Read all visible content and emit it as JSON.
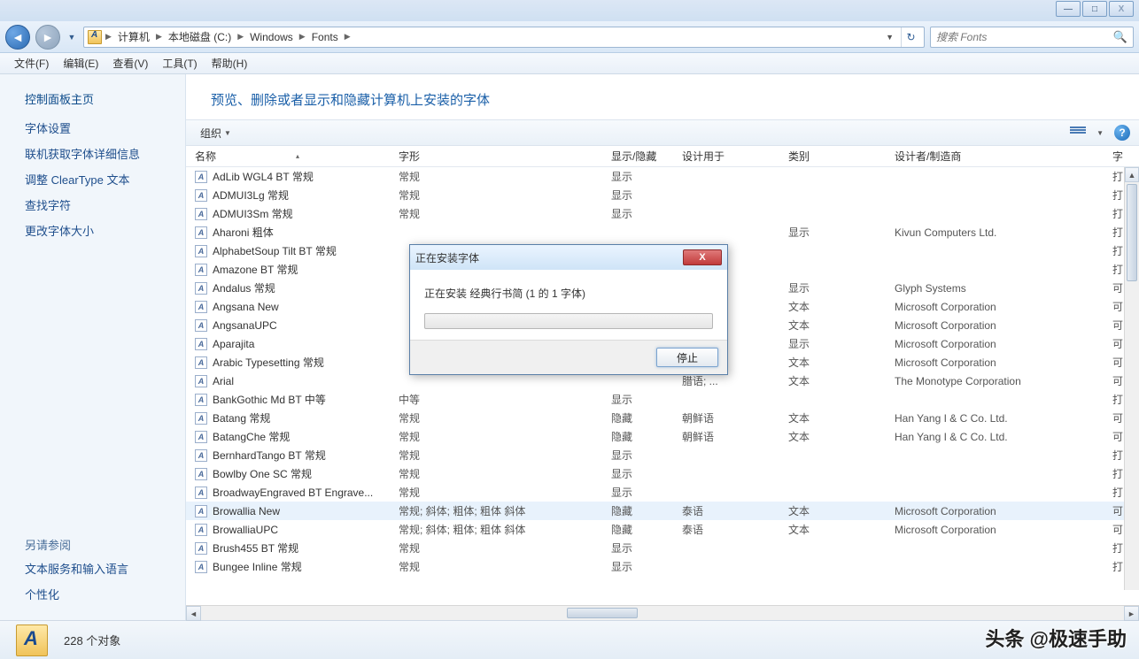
{
  "titlebar": {
    "minimize": "—",
    "maximize": "□",
    "close": "X"
  },
  "nav": {
    "crumbs": [
      "计算机",
      "本地磁盘 (C:)",
      "Windows",
      "Fonts"
    ],
    "search_placeholder": "搜索 Fonts"
  },
  "menus": [
    "文件(F)",
    "编辑(E)",
    "查看(V)",
    "工具(T)",
    "帮助(H)"
  ],
  "sidebar": {
    "home": "控制面板主页",
    "links": [
      "字体设置",
      "联机获取字体详细信息",
      "调整 ClearType 文本",
      "查找字符",
      "更改字体大小"
    ],
    "see_also": "另请参阅",
    "sub": [
      "文本服务和输入语言",
      "个性化"
    ]
  },
  "heading": "预览、删除或者显示和隐藏计算机上安装的字体",
  "toolbar": {
    "organize": "组织"
  },
  "columns": {
    "name": "名称",
    "style": "字形",
    "show": "显示/隐藏",
    "designfor": "设计用于",
    "category": "类别",
    "designer": "设计者/制造商",
    "ext": "字"
  },
  "rows": [
    {
      "n": "AdLib WGL4 BT 常规",
      "s": "常规",
      "sh": "显示",
      "df": "",
      "c": "",
      "d": "",
      "e": "打"
    },
    {
      "n": "ADMUI3Lg 常规",
      "s": "常规",
      "sh": "显示",
      "df": "",
      "c": "",
      "d": "",
      "e": "打"
    },
    {
      "n": "ADMUI3Sm 常规",
      "s": "常规",
      "sh": "显示",
      "df": "",
      "c": "",
      "d": "",
      "e": "打"
    },
    {
      "n": "Aharoni 粗体",
      "s": "",
      "sh": "",
      "df": "",
      "c": "显示",
      "d": "Kivun Computers Ltd.",
      "e": "打"
    },
    {
      "n": "AlphabetSoup Tilt BT 常规",
      "s": "",
      "sh": "",
      "df": "",
      "c": "",
      "d": "",
      "e": "打"
    },
    {
      "n": "Amazone BT 常规",
      "s": "",
      "sh": "",
      "df": "",
      "c": "",
      "d": "",
      "e": "打"
    },
    {
      "n": "Andalus 常规",
      "s": "",
      "sh": "",
      "df": "",
      "c": "显示",
      "d": "Glyph Systems",
      "e": "可"
    },
    {
      "n": "Angsana New",
      "s": "",
      "sh": "",
      "df": "",
      "c": "文本",
      "d": "Microsoft Corporation",
      "e": "可"
    },
    {
      "n": "AngsanaUPC",
      "s": "",
      "sh": "",
      "df": "",
      "c": "文本",
      "d": "Microsoft Corporation",
      "e": "可"
    },
    {
      "n": "Aparajita",
      "s": "",
      "sh": "",
      "df": "",
      "c": "显示",
      "d": "Microsoft Corporation",
      "e": "可"
    },
    {
      "n": "Arabic Typesetting 常规",
      "s": "",
      "sh": "",
      "df": "",
      "c": "文本",
      "d": "Microsoft Corporation",
      "e": "可"
    },
    {
      "n": "Arial",
      "s": "",
      "sh": "",
      "df": "腊语; ...",
      "c": "文本",
      "d": "The Monotype Corporation",
      "e": "可"
    },
    {
      "n": "BankGothic Md BT 中等",
      "s": "中等",
      "sh": "显示",
      "df": "",
      "c": "",
      "d": "",
      "e": "打"
    },
    {
      "n": "Batang 常规",
      "s": "常规",
      "sh": "隐藏",
      "df": "朝鲜语",
      "c": "文本",
      "d": "Han Yang I & C Co. Ltd.",
      "e": "可"
    },
    {
      "n": "BatangChe 常规",
      "s": "常规",
      "sh": "隐藏",
      "df": "朝鲜语",
      "c": "文本",
      "d": "Han Yang I & C Co. Ltd.",
      "e": "可"
    },
    {
      "n": "BernhardTango BT 常规",
      "s": "常规",
      "sh": "显示",
      "df": "",
      "c": "",
      "d": "",
      "e": "打"
    },
    {
      "n": "Bowlby One SC 常规",
      "s": "常规",
      "sh": "显示",
      "df": "",
      "c": "",
      "d": "",
      "e": "打"
    },
    {
      "n": "BroadwayEngraved BT Engrave...",
      "s": "常规",
      "sh": "显示",
      "df": "",
      "c": "",
      "d": "",
      "e": "打"
    },
    {
      "n": "Browallia New",
      "s": "常规; 斜体; 粗体; 粗体 斜体",
      "sh": "隐藏",
      "df": "泰语",
      "c": "文本",
      "d": "Microsoft Corporation",
      "e": "可",
      "hover": true
    },
    {
      "n": "BrowalliaUPC",
      "s": "常规; 斜体; 粗体; 粗体 斜体",
      "sh": "隐藏",
      "df": "泰语",
      "c": "文本",
      "d": "Microsoft Corporation",
      "e": "可"
    },
    {
      "n": "Brush455 BT 常规",
      "s": "常规",
      "sh": "显示",
      "df": "",
      "c": "",
      "d": "",
      "e": "打"
    },
    {
      "n": "Bungee Inline 常规",
      "s": "常规",
      "sh": "显示",
      "df": "",
      "c": "",
      "d": "",
      "e": "打"
    }
  ],
  "status": {
    "count": "228 个对象"
  },
  "dialog": {
    "title": "正在安装字体",
    "body": "正在安装 经典行书简 (1 的 1 字体)",
    "stop": "停止"
  },
  "watermark": "头条 @极速手助"
}
